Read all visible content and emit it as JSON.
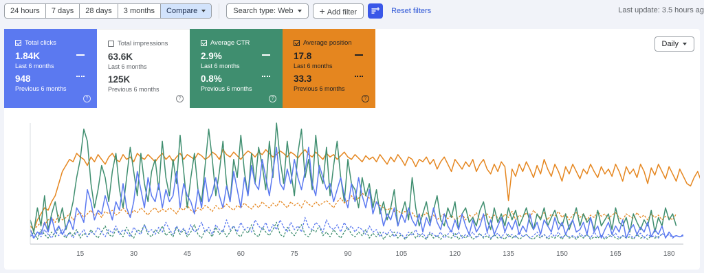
{
  "toolbar": {
    "ranges": [
      "24 hours",
      "7 days",
      "28 days",
      "3 months"
    ],
    "compare_label": "Compare",
    "search_type": "Search type: Web",
    "add_filter": "Add filter",
    "reset_filters": "Reset filters",
    "last_update": "Last update: 3.5 hours ag"
  },
  "metrics": {
    "clicks": {
      "label": "Total clicks",
      "value": "1.84K",
      "period": "Last 6 months",
      "prev_value": "948",
      "prev_period": "Previous 6 months",
      "color": "#5b79f0",
      "checked": true
    },
    "impressions": {
      "label": "Total impressions",
      "value": "63.6K",
      "period": "Last 6 months",
      "prev_value": "125K",
      "prev_period": "Previous 6 months",
      "checked": false
    },
    "ctr": {
      "label": "Average CTR",
      "value": "2.9%",
      "period": "Last 6 months",
      "prev_value": "0.8%",
      "prev_period": "Previous 6 months",
      "color": "#3f8e6f",
      "checked": true
    },
    "position": {
      "label": "Average position",
      "value": "17.8",
      "period": "Last 6 months",
      "prev_value": "33.3",
      "prev_period": "Previous 6 months",
      "color": "#e5861f",
      "checked": true
    },
    "help_glyph": "?"
  },
  "granularity": "Daily",
  "chart_data": {
    "type": "line",
    "x_ticks": [
      "15",
      "30",
      "45",
      "60",
      "75",
      "90",
      "105",
      "120",
      "135",
      "150",
      "165",
      "180"
    ],
    "x_range": [
      1,
      184
    ],
    "grid": false,
    "series": [
      {
        "name": "Total clicks",
        "color": "#5b79f0",
        "style": "solid",
        "values": [
          0.12,
          0.05,
          0.1,
          0.08,
          0.18,
          0.1,
          0.22,
          0.1,
          0.15,
          0.08,
          0.14,
          0.2,
          0.12,
          0.3,
          0.25,
          0.18,
          0.45,
          0.35,
          0.2,
          0.28,
          0.25,
          0.4,
          0.3,
          0.2,
          0.35,
          0.28,
          0.5,
          0.3,
          0.22,
          0.35,
          0.6,
          0.45,
          0.3,
          0.55,
          0.4,
          0.35,
          0.5,
          0.3,
          0.45,
          0.35,
          0.4,
          0.6,
          0.3,
          0.5,
          0.4,
          0.35,
          0.25,
          0.45,
          0.3,
          0.55,
          0.35,
          0.42,
          0.55,
          0.4,
          0.3,
          0.48,
          0.35,
          0.6,
          0.45,
          0.3,
          0.55,
          0.4,
          0.65,
          0.5,
          0.45,
          0.7,
          0.55,
          0.4,
          0.6,
          0.8,
          0.5,
          0.45,
          0.62,
          0.5,
          0.7,
          0.55,
          0.45,
          0.6,
          0.8,
          0.5,
          0.4,
          0.65,
          0.55,
          0.45,
          0.5,
          0.35,
          0.45,
          0.55,
          0.4,
          0.3,
          0.5,
          0.35,
          0.55,
          0.4,
          0.3,
          0.45,
          0.25,
          0.35,
          0.3,
          0.15,
          0.25,
          0.2,
          0.3,
          0.15,
          0.25,
          0.18,
          0.3,
          0.2,
          0.15,
          0.25,
          0.1,
          0.22,
          0.15,
          0.3,
          0.18,
          0.12,
          0.25,
          0.15,
          0.1,
          0.2,
          0.12,
          0.25,
          0.15,
          0.08,
          0.2,
          0.1,
          0.15,
          0.25,
          0.1,
          0.2,
          0.08,
          0.15,
          0.22,
          0.1,
          0.18,
          0.12,
          0.2,
          0.08,
          0.15,
          0.1,
          0.25,
          0.12,
          0.18,
          0.08,
          0.2,
          0.15,
          0.1,
          0.22,
          0.12,
          0.18,
          0.08,
          0.15,
          0.2,
          0.1,
          0.12,
          0.18,
          0.08,
          0.22,
          0.1,
          0.15,
          0.05,
          0.12,
          0.18,
          0.08,
          0.15,
          0.1,
          0.2,
          0.05,
          0.12,
          0.16,
          0.08,
          0.14,
          0.1,
          0.18,
          0.06,
          0.12,
          0.08,
          0.15,
          0.05,
          0.1,
          0.06,
          0.07,
          0.06,
          0.07
        ]
      },
      {
        "name": "Average CTR",
        "color": "#3f8e6f",
        "style": "solid",
        "values": [
          0.2,
          0.1,
          0.3,
          0.15,
          0.4,
          0.12,
          0.25,
          0.35,
          0.18,
          0.3,
          0.12,
          0.22,
          0.35,
          0.55,
          0.7,
          0.95,
          0.85,
          0.5,
          0.3,
          0.45,
          0.65,
          0.55,
          0.35,
          0.6,
          0.75,
          0.45,
          0.3,
          0.55,
          0.8,
          0.6,
          0.4,
          0.75,
          0.5,
          0.35,
          0.6,
          0.7,
          0.45,
          0.85,
          0.55,
          0.4,
          0.7,
          0.5,
          0.9,
          0.6,
          0.3,
          0.55,
          0.75,
          0.45,
          0.35,
          0.65,
          0.95,
          0.7,
          0.4,
          0.6,
          0.85,
          0.5,
          0.35,
          0.7,
          0.55,
          0.9,
          0.6,
          0.4,
          0.75,
          0.5,
          0.8,
          0.65,
          0.45,
          0.85,
          0.55,
          1.0,
          0.7,
          0.5,
          0.85,
          0.6,
          0.4,
          0.75,
          0.95,
          0.55,
          0.7,
          0.45,
          0.9,
          0.6,
          0.5,
          0.8,
          0.4,
          0.65,
          0.85,
          0.55,
          0.35,
          0.7,
          0.5,
          0.45,
          0.3,
          0.55,
          0.4,
          0.5,
          0.3,
          0.45,
          0.25,
          0.35,
          0.2,
          0.3,
          0.45,
          0.15,
          0.25,
          0.35,
          0.2,
          0.55,
          0.3,
          0.15,
          0.25,
          0.35,
          0.18,
          0.28,
          0.4,
          0.2,
          0.15,
          0.3,
          0.22,
          0.35,
          0.12,
          0.25,
          0.3,
          0.18,
          0.22,
          0.15,
          0.28,
          0.35,
          0.2,
          0.12,
          0.3,
          0.18,
          0.25,
          0.15,
          0.3,
          0.2,
          0.28,
          0.15,
          0.22,
          0.3,
          0.18,
          0.12,
          0.25,
          0.2,
          0.3,
          0.15,
          0.22,
          0.28,
          0.18,
          0.15,
          0.25,
          0.12,
          0.2,
          0.3,
          0.15,
          0.25,
          0.18,
          0.22,
          0.12,
          0.28,
          0.15,
          0.2,
          0.25,
          0.12,
          0.3,
          0.18,
          0.15,
          0.22,
          0.1,
          0.25,
          0.18,
          0.12,
          0.2,
          0.15,
          0.28,
          0.1,
          0.22,
          0.15,
          0.3,
          0.2,
          0.25,
          0.15
        ]
      },
      {
        "name": "Average position",
        "color": "#e5861f",
        "style": "solid",
        "values": [
          0.15,
          0.12,
          0.2,
          0.25,
          0.3,
          0.28,
          0.35,
          0.4,
          0.5,
          0.6,
          0.65,
          0.7,
          0.68,
          0.75,
          0.72,
          0.7,
          0.65,
          0.72,
          0.68,
          0.74,
          0.7,
          0.66,
          0.72,
          0.75,
          0.7,
          0.68,
          0.74,
          0.7,
          0.72,
          0.68,
          0.75,
          0.72,
          0.7,
          0.74,
          0.71,
          0.68,
          0.72,
          0.75,
          0.7,
          0.73,
          0.68,
          0.72,
          0.75,
          0.7,
          0.74,
          0.72,
          0.7,
          0.75,
          0.73,
          0.7,
          0.72,
          0.76,
          0.74,
          0.7,
          0.78,
          0.74,
          0.72,
          0.76,
          0.73,
          0.7,
          0.74,
          0.77,
          0.75,
          0.72,
          0.76,
          0.74,
          0.78,
          0.75,
          0.72,
          0.74,
          0.77,
          0.75,
          0.72,
          0.76,
          0.74,
          0.71,
          0.75,
          0.78,
          0.74,
          0.72,
          0.76,
          0.73,
          0.7,
          0.75,
          0.72,
          0.74,
          0.7,
          0.73,
          0.76,
          0.72,
          0.7,
          0.74,
          0.71,
          0.68,
          0.73,
          0.7,
          0.72,
          0.68,
          0.74,
          0.7,
          0.66,
          0.72,
          0.68,
          0.74,
          0.7,
          0.65,
          0.72,
          0.7,
          0.64,
          0.7,
          0.68,
          0.72,
          0.66,
          0.7,
          0.62,
          0.68,
          0.72,
          0.66,
          0.6,
          0.7,
          0.66,
          0.62,
          0.68,
          0.64,
          0.7,
          0.6,
          0.66,
          0.7,
          0.62,
          0.58,
          0.66,
          0.6,
          0.68,
          0.64,
          0.36,
          0.62,
          0.56,
          0.66,
          0.6,
          0.68,
          0.62,
          0.55,
          0.65,
          0.58,
          0.7,
          0.62,
          0.56,
          0.66,
          0.6,
          0.52,
          0.64,
          0.58,
          0.66,
          0.6,
          0.54,
          0.62,
          0.58,
          0.66,
          0.6,
          0.55,
          0.64,
          0.58,
          0.62,
          0.56,
          0.66,
          0.6,
          0.52,
          0.64,
          0.58,
          0.62,
          0.55,
          0.66,
          0.6,
          0.5,
          0.63,
          0.57,
          0.66,
          0.6,
          0.54,
          0.64,
          0.58,
          0.52,
          0.62,
          0.56,
          0.5,
          0.48,
          0.55,
          0.6,
          0.52,
          0.46
        ]
      },
      {
        "name": "Total clicks (previous)",
        "color": "#5b79f0",
        "style": "dashed",
        "values": [
          0.08,
          0.05,
          0.1,
          0.06,
          0.12,
          0.08,
          0.05,
          0.1,
          0.07,
          0.12,
          0.06,
          0.09,
          0.05,
          0.1,
          0.08,
          0.12,
          0.06,
          0.1,
          0.08,
          0.14,
          0.1,
          0.06,
          0.12,
          0.09,
          0.15,
          0.08,
          0.12,
          0.1,
          0.06,
          0.14,
          0.1,
          0.08,
          0.16,
          0.1,
          0.12,
          0.08,
          0.14,
          0.1,
          0.18,
          0.12,
          0.08,
          0.15,
          0.1,
          0.13,
          0.08,
          0.16,
          0.1,
          0.12,
          0.18,
          0.1,
          0.14,
          0.08,
          0.16,
          0.12,
          0.1,
          0.2,
          0.12,
          0.15,
          0.1,
          0.18,
          0.12,
          0.14,
          0.1,
          0.2,
          0.15,
          0.12,
          0.18,
          0.1,
          0.16,
          0.12,
          0.2,
          0.14,
          0.1,
          0.18,
          0.12,
          0.15,
          0.1,
          0.22,
          0.14,
          0.12,
          0.18,
          0.15,
          0.1,
          0.2,
          0.14,
          0.12,
          0.16,
          0.1,
          0.18,
          0.12,
          0.15,
          0.1,
          0.14,
          0.12,
          0.08,
          0.15,
          0.1,
          0.12,
          0.06,
          0.1,
          0.08,
          0.12,
          0.06,
          0.1,
          0.08,
          0.05,
          0.1,
          0.07,
          0.12,
          0.06,
          0.09,
          0.05,
          0.1,
          0.08,
          0.06,
          0.1,
          0.05,
          0.08,
          0.12,
          0.06,
          0.1,
          0.05,
          0.08,
          0.06,
          0.1,
          0.05,
          0.08,
          0.06,
          0.1,
          0.05,
          0.07,
          0.09,
          0.05,
          0.1,
          0.06,
          0.08,
          0.05,
          0.1,
          0.06,
          0.08,
          0.05,
          0.07,
          0.1,
          0.06,
          0.08,
          0.05,
          0.09,
          0.06,
          0.1,
          0.05,
          0.08,
          0.06,
          0.07,
          0.05,
          0.09,
          0.06,
          0.08,
          0.05,
          0.1,
          0.06,
          0.07,
          0.05,
          0.08,
          0.06,
          0.09,
          0.05,
          0.07,
          0.06,
          0.08,
          0.05,
          0.07,
          0.09,
          0.05,
          0.08,
          0.06,
          0.07,
          0.05,
          0.09,
          0.06,
          0.08,
          0.05,
          0.07,
          0.06,
          0.08
        ]
      },
      {
        "name": "Average CTR (previous)",
        "color": "#3f8e6f",
        "style": "dashed",
        "values": [
          0.06,
          0.1,
          0.04,
          0.12,
          0.08,
          0.05,
          0.1,
          0.06,
          0.14,
          0.08,
          0.05,
          0.1,
          0.07,
          0.12,
          0.05,
          0.09,
          0.06,
          0.12,
          0.08,
          0.05,
          0.1,
          0.15,
          0.08,
          0.06,
          0.12,
          0.1,
          0.06,
          0.14,
          0.08,
          0.05,
          0.12,
          0.1,
          0.16,
          0.08,
          0.06,
          0.12,
          0.09,
          0.15,
          0.07,
          0.1,
          0.06,
          0.14,
          0.08,
          0.12,
          0.06,
          0.1,
          0.16,
          0.08,
          0.05,
          0.12,
          0.1,
          0.06,
          0.14,
          0.08,
          0.12,
          0.06,
          0.1,
          0.15,
          0.08,
          0.06,
          0.12,
          0.09,
          0.16,
          0.08,
          0.06,
          0.14,
          0.1,
          0.07,
          0.12,
          0.18,
          0.08,
          0.06,
          0.14,
          0.1,
          0.07,
          0.12,
          0.16,
          0.08,
          0.06,
          0.12,
          0.1,
          0.15,
          0.07,
          0.1,
          0.06,
          0.12,
          0.08,
          0.05,
          0.1,
          0.14,
          0.08,
          0.06,
          0.1,
          0.07,
          0.12,
          0.05,
          0.09,
          0.06,
          0.1,
          0.04,
          0.08,
          0.06,
          0.1,
          0.05,
          0.08,
          0.04,
          0.07,
          0.1,
          0.05,
          0.08,
          0.06,
          0.04,
          0.09,
          0.05,
          0.07,
          0.04,
          0.08,
          0.06,
          0.05,
          0.09,
          0.04,
          0.07,
          0.05,
          0.08,
          0.04,
          0.06,
          0.09,
          0.05,
          0.07,
          0.04,
          0.08,
          0.05,
          0.06,
          0.04,
          0.08,
          0.05,
          0.07,
          0.04,
          0.06,
          0.08,
          0.05,
          0.04,
          0.07,
          0.05,
          0.08,
          0.04,
          0.06,
          0.05,
          0.07,
          0.04,
          0.08,
          0.05,
          0.06,
          0.04,
          0.07,
          0.05,
          0.08,
          0.04,
          0.06,
          0.05,
          0.07,
          0.04,
          0.06,
          0.08,
          0.05,
          0.04,
          0.07,
          0.05,
          0.06,
          0.04,
          0.08,
          0.05,
          0.06,
          0.04,
          0.07,
          0.05,
          0.06,
          0.08
        ]
      },
      {
        "name": "Average position (previous)",
        "color": "#e5861f",
        "style": "dashed",
        "values": [
          0.1,
          0.12,
          0.15,
          0.18,
          0.16,
          0.2,
          0.22,
          0.18,
          0.24,
          0.2,
          0.22,
          0.25,
          0.2,
          0.24,
          0.26,
          0.22,
          0.25,
          0.28,
          0.24,
          0.26,
          0.22,
          0.27,
          0.25,
          0.28,
          0.24,
          0.26,
          0.3,
          0.26,
          0.24,
          0.28,
          0.26,
          0.3,
          0.27,
          0.24,
          0.28,
          0.3,
          0.26,
          0.29,
          0.27,
          0.3,
          0.28,
          0.25,
          0.3,
          0.28,
          0.32,
          0.28,
          0.26,
          0.3,
          0.28,
          0.32,
          0.3,
          0.27,
          0.32,
          0.29,
          0.3,
          0.33,
          0.3,
          0.28,
          0.32,
          0.3,
          0.34,
          0.31,
          0.29,
          0.33,
          0.3,
          0.35,
          0.32,
          0.3,
          0.34,
          0.31,
          0.36,
          0.33,
          0.3,
          0.35,
          0.32,
          0.34,
          0.3,
          0.36,
          0.33,
          0.31,
          0.35,
          0.32,
          0.34,
          0.36,
          0.33,
          0.3,
          0.35,
          0.38,
          0.34,
          0.36,
          0.4,
          0.36,
          0.38,
          0.42,
          0.4,
          0.38,
          0.36,
          0.34,
          0.32,
          0.3,
          0.28,
          0.3,
          0.27,
          0.28,
          0.25,
          0.27,
          0.24,
          0.26,
          0.22,
          0.25,
          0.23,
          0.26,
          0.22,
          0.24,
          0.2,
          0.23,
          0.25,
          0.21,
          0.24,
          0.2,
          0.22,
          0.25,
          0.2,
          0.24,
          0.22,
          0.26,
          0.2,
          0.23,
          0.25,
          0.21,
          0.24,
          0.22,
          0.2,
          0.25,
          0.22,
          0.27,
          0.2,
          0.24,
          0.22,
          0.26,
          0.21,
          0.28,
          0.24,
          0.22,
          0.26,
          0.2,
          0.25,
          0.23,
          0.27,
          0.22,
          0.25,
          0.2,
          0.24,
          0.26,
          0.22,
          0.25,
          0.2,
          0.24,
          0.22,
          0.27,
          0.23,
          0.25,
          0.21,
          0.24,
          0.26,
          0.22,
          0.2,
          0.25,
          0.23,
          0.21,
          0.26,
          0.22,
          0.24,
          0.2,
          0.25,
          0.22,
          0.24,
          0.2,
          0.23,
          0.22,
          0.2,
          0.25
        ]
      }
    ]
  }
}
